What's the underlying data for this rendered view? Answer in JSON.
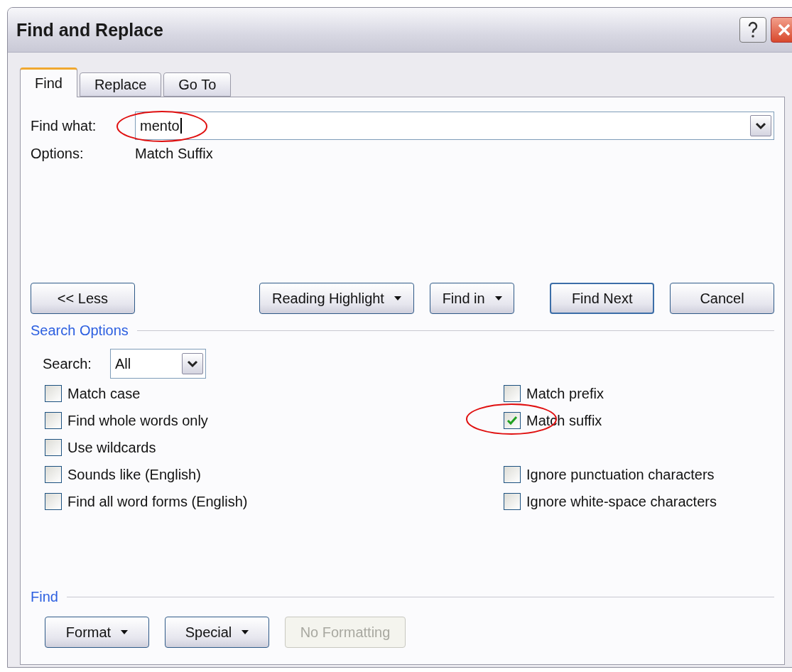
{
  "window": {
    "title": "Find and Replace"
  },
  "tabs": [
    {
      "label": "Find",
      "selected": true
    },
    {
      "label": "Replace",
      "selected": false
    },
    {
      "label": "Go To",
      "selected": false
    }
  ],
  "find_what": {
    "label": "Find what:",
    "value": "mento"
  },
  "options": {
    "label": "Options:",
    "value": "Match Suffix"
  },
  "buttons": [
    {
      "label": "<< Less",
      "kind": "plain",
      "default": false
    },
    {
      "label": "Reading Highlight",
      "kind": "dropdown",
      "default": false
    },
    {
      "label": "Find in",
      "kind": "dropdown",
      "default": false
    },
    {
      "label": "Find Next",
      "kind": "plain",
      "default": true
    },
    {
      "label": "Cancel",
      "kind": "plain",
      "default": false
    }
  ],
  "search_options": {
    "title": "Search Options",
    "search_label": "Search:",
    "search_value": "All",
    "rows": [
      {
        "left": {
          "label": "Match case",
          "checked": false
        },
        "right": {
          "label": "Match prefix",
          "checked": false
        }
      },
      {
        "left": {
          "label": "Find whole words only",
          "checked": false
        },
        "right": {
          "label": "Match suffix",
          "checked": true
        }
      },
      {
        "left": {
          "label": "Use wildcards",
          "checked": false
        }
      },
      {
        "left": {
          "label": "Sounds like (English)",
          "checked": false
        },
        "right": {
          "label": "Ignore punctuation characters",
          "checked": false
        }
      },
      {
        "left": {
          "label": "Find all word forms (English)",
          "checked": false
        },
        "right": {
          "label": "Ignore white-space characters",
          "checked": false
        }
      }
    ]
  },
  "find_section": {
    "title": "Find",
    "buttons": [
      {
        "label": "Format",
        "kind": "dropdown",
        "disabled": false
      },
      {
        "label": "Special",
        "kind": "dropdown",
        "disabled": false
      },
      {
        "label": "No Formatting",
        "kind": "plain",
        "disabled": true
      }
    ]
  }
}
